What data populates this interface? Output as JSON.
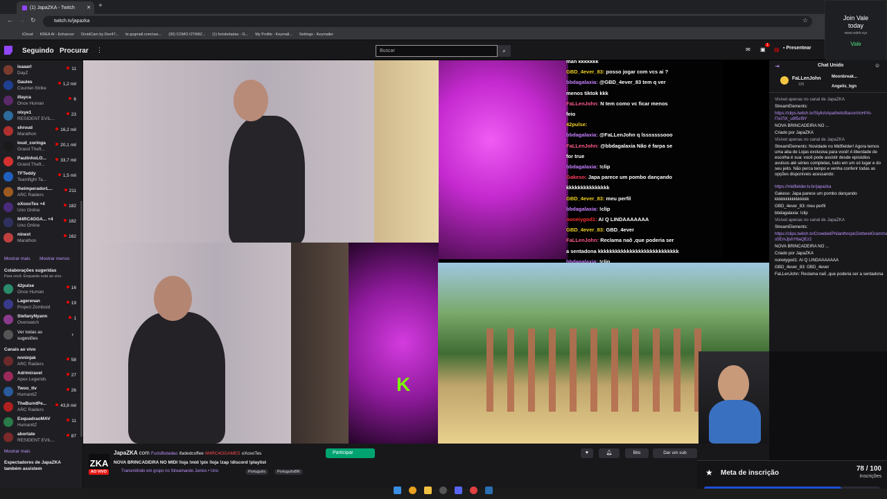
{
  "browser": {
    "tab_title": "(1) JapaZKA - Twitch",
    "url": "twitch.tv/japazka",
    "bookmarks": [
      "iCloud",
      "KREA AI - Enhancer",
      "DroidCam by Dev47...",
      "br.gvgmall.com/use...",
      "(30) COMO OTIMIZ...",
      "(1) furisboladao - G...",
      "My Profile - Keymall...",
      "Settings - Keymailer"
    ]
  },
  "ad": {
    "line1": "Join Vale",
    "line2": "today",
    "url": "www.valeh.xyz",
    "brand": "Vale"
  },
  "topnav": {
    "seguindo": "Seguindo",
    "procurar": "Procurar",
    "search_placeholder": "Buscar",
    "present": "Presentear",
    "notif_count": "1"
  },
  "sidebar": {
    "followed": [
      {
        "name": "isaaarl",
        "game": "DayZ",
        "viewers": "11",
        "color": "#7a3b2e"
      },
      {
        "name": "Gaules",
        "game": "Counter-Strike",
        "viewers": "1,2 mil",
        "color": "#1f3f8f"
      },
      {
        "name": "illayca",
        "game": "Once Human",
        "viewers": "6",
        "color": "#5a2a6a"
      },
      {
        "name": "nlxye1",
        "game": "RESIDENT EVIL...",
        "viewers": "23",
        "color": "#2d6b9c"
      },
      {
        "name": "shroud",
        "game": "Marathon",
        "viewers": "16,2 mil",
        "color": "#b03030"
      },
      {
        "name": "loud_coringa",
        "game": "Grand Theft...",
        "viewers": "20,1 mil",
        "color": "#1a1a1a"
      },
      {
        "name": "PaulinhoLO...",
        "game": "Grand Theft...",
        "viewers": "33,7 mil",
        "color": "#d43030"
      },
      {
        "name": "TFTeddy",
        "game": "Teamfight Ta...",
        "viewers": "1,5 mil",
        "color": "#2060c0"
      },
      {
        "name": "theimperadorL...",
        "game": "ARC Raiders",
        "viewers": "211",
        "color": "#9a5a20"
      },
      {
        "name": "oXoxoTes +4",
        "game": "Uno Online",
        "viewers": "182",
        "color": "#4a2a7a"
      },
      {
        "name": "M4RC4OGA... +4",
        "game": "Uno Online",
        "viewers": "182",
        "color": "#303060"
      },
      {
        "name": "ninext",
        "game": "Marathon",
        "viewers": "162",
        "color": "#c04040"
      }
    ],
    "show_more": "Mostrar mais",
    "show_less": "Mostrar menos",
    "collab_title": "Colaborações sugeridas",
    "collab_sub": "Para você. Enquanto está ao vivo.",
    "collab": [
      {
        "name": "42pulse",
        "game": "Once Human",
        "viewers": "16",
        "color": "#2a8a6a"
      },
      {
        "name": "Lagerenan",
        "game": "Project Zomboid",
        "viewers": "19",
        "color": "#3a3a8a"
      },
      {
        "name": "StefanyNyann",
        "game": "Overwatch",
        "viewers": "1",
        "color": "#8a3a8a"
      }
    ],
    "see_all": "Ver todas as sugestões",
    "live_title": "Canais ao vivo",
    "live": [
      {
        "name": "nnninjak",
        "game": "ARC Raiders",
        "viewers": "58",
        "color": "#6a2a2a"
      },
      {
        "name": "Adrimiravel",
        "game": "Apex Legends",
        "viewers": "27",
        "color": "#9a2a5a"
      },
      {
        "name": "Twoo_ttv",
        "game": "HumanitZ",
        "viewers": "26",
        "color": "#2a5a9a"
      },
      {
        "name": "TheBurntPe...",
        "game": "ARC Raiders",
        "viewers": "43,8 mil",
        "color": "#b02020"
      },
      {
        "name": "EsquadraoMAV",
        "game": "HumanitZ",
        "viewers": "11",
        "color": "#2a7a4a"
      },
      {
        "name": "abortate",
        "game": "RESIDENT EVIL...",
        "viewers": "87",
        "color": "#7a2a2a"
      }
    ],
    "show_more2": "Mostrar mais",
    "viewers_also": "Espectadores de JapaZKA também assistem"
  },
  "overlay_chat": [
    {
      "user": "",
      "msg": "man kkkkkkk",
      "ucolor": "#fff"
    },
    {
      "user": "GBD_4ever_83:",
      "msg": "posso jogar com vcs ai ?",
      "ucolor": "#f0d020"
    },
    {
      "user": "bbdagalaxia:",
      "msg": "@GBD_4ever_83 tem q ver",
      "ucolor": "#c880ff"
    },
    {
      "user": "",
      "msg": "menos tiktok kkk",
      "ucolor": "#fff"
    },
    {
      "user": "FaLLenJohn:",
      "msg": "N tem como vc ficar menos",
      "ucolor": "#ff5a8a"
    },
    {
      "user": "",
      "msg": "feio",
      "ucolor": "#fff"
    },
    {
      "user": "42pulse:",
      "msg": "",
      "ucolor": "#f0d020"
    },
    {
      "user": "bbdagalaxia:",
      "msg": "@FaLLenJohn q lsssssssooo",
      "ucolor": "#c880ff"
    },
    {
      "user": "FaLLenJohn:",
      "msg": "@bbdagalaxia Não é farpa se",
      "ucolor": "#ff5a8a"
    },
    {
      "user": "",
      "msg": "for true",
      "ucolor": "#fff"
    },
    {
      "user": "bbdagalaxia:",
      "msg": "!clip",
      "ucolor": "#c880ff"
    },
    {
      "user": "Gakeso:",
      "msg": "Japa parece um pombo dançando",
      "ucolor": "#ff4060"
    },
    {
      "user": "",
      "msg": "kkkkkkkkkkkkkkk",
      "ucolor": "#fff"
    },
    {
      "user": "GBD_4ever_83:",
      "msg": "meu perfil",
      "ucolor": "#f0d020"
    },
    {
      "user": "bbdagalaxia:",
      "msg": "!clip",
      "ucolor": "#c880ff"
    },
    {
      "user": "noneiygod1:",
      "msg": "AI Q LINDAAAAAAA",
      "ucolor": "#ff3030"
    },
    {
      "user": "GBD_4ever_83:",
      "msg": "GBD_4ever",
      "ucolor": "#f0d020"
    },
    {
      "user": "FaLLenJohn:",
      "msg": "Reclama naõ ,que poderia ser",
      "ucolor": "#ff5a8a"
    },
    {
      "user": "",
      "msg": "a sentadona kkkkkkkkkkkkkkkkkkkkkkkkkkkk",
      "ucolor": "#fff"
    },
    {
      "user": "bbdagalaxia:",
      "msg": "!clip",
      "ucolor": "#c880ff"
    }
  ],
  "video_text": "K",
  "stream": {
    "logo": "ZKA",
    "streamer": "JapaZKA",
    "com": "com",
    "collabs": [
      "FurisBoladao",
      "ifadedcoffee",
      "M4RC4OGAMES",
      "oXoxoTes"
    ],
    "join": "Participar",
    "title": "NOVA BRINCADEIRA NO MIDI !loja !mid !pix !loja !zap !discord !playlist",
    "live_badge": "AO VIVO",
    "group": "Transmitindo em grupo no Streamando Juntos • Uno",
    "tags": [
      "Português",
      "PortuguêsBR"
    ],
    "bits": "Bits",
    "gift": "Dar um sub"
  },
  "chat": {
    "header": "Chat Unido",
    "top_user": "FaLLenJohn",
    "top_count": "125",
    "top_others": [
      "Moonbreak...",
      "Angelis_bgn"
    ],
    "lines": [
      "Visível apenas no canal de JapaZKA",
      "StreamElements:",
      "https://clips.twitch.tv/StylishApatheticBaconVoHiYo-f7el7lX_u9f5cf9Y",
      "NOVA BRINCADEIRA NO ...",
      "Criado por JapaZKA",
      "Visível apenas no canal de JapaZKA",
      "StreamElements: Novidade no Midfielder! Agora temos uma aba de Lojas exclusiva para você! A liberdade de escolha é sua: você pode assistir desde episódios avulsos até séries completas, tudo em um só lugar e do seu jeito. Não perca tempo e venha conferir todas as opções disponíveis acessando:",
      "https://midfielder.tv.br/japazka",
      "Gakeso: Japa parece um pombo dançando kkkkkkkkkkkkkkkk",
      "GBD_4ever_83: meu perfil",
      "bbdagalaxia: !clip",
      "Visível apenas no canal de JapaZKA",
      "StreamElements:",
      "https://clips.twitch.tv/CrowdedPhilanthropicDotterelGrammarKing-s5EmJjshY6aQEz2",
      "NOVA BRINCADEIRA NO ...",
      "Criado por JapaZKA",
      "noneiygod1: AI Q LINDAAAAAAA",
      "GBD_4ever_83: GBD_4ever",
      "FaLLenJohn: Reclama naõ ,que poderia ser a sentadona"
    ]
  },
  "goal": {
    "label": "Meta de inscrição",
    "value": "78 / 100",
    "unit": "Inscrições",
    "progress": 0.78
  }
}
